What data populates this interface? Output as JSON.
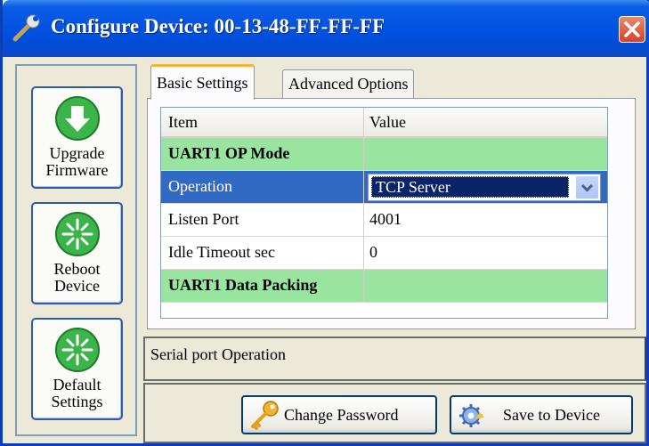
{
  "window": {
    "title": "Configure Device: 00-13-48-FF-FF-FF"
  },
  "sidebar": {
    "upgrade": {
      "line1": "Upgrade",
      "line2": "Firmware"
    },
    "reboot": {
      "line1": "Reboot",
      "line2": "Device"
    },
    "default": {
      "line1": "Default",
      "line2": "Settings"
    }
  },
  "tabs": {
    "basic": "Basic Settings",
    "advanced": "Advanced Options"
  },
  "grid": {
    "headers": {
      "item": "Item",
      "value": "Value"
    },
    "rows": [
      {
        "item": "UART1 OP Mode",
        "value": ""
      },
      {
        "item": "Operation",
        "value": "TCP Server"
      },
      {
        "item": "Listen Port",
        "value": "4001"
      },
      {
        "item": "Idle Timeout sec",
        "value": "0"
      },
      {
        "item": "UART1 Data Packing",
        "value": ""
      }
    ]
  },
  "description": "Serial port Operation",
  "buttons": {
    "change_password": "Change Password",
    "save_to_device": "Save to Device"
  },
  "colors": {
    "title_bar": "#0050e0",
    "group_row": "#99e5a0",
    "selected_row": "#316ac5"
  }
}
